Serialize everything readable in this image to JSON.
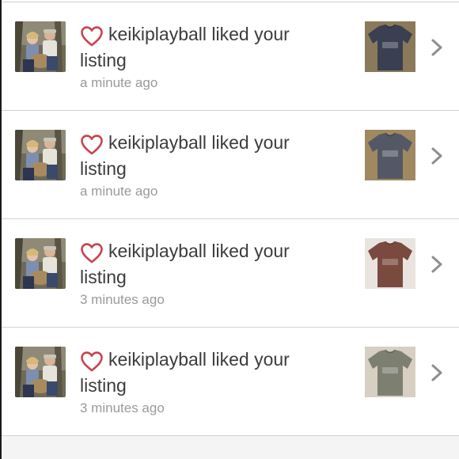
{
  "notifications": [
    {
      "username": "keikiplayball",
      "message": "keikiplayball liked your listing",
      "time": "a minute ago",
      "avatar_icon": "user-photo",
      "item_color": "#3a3f52",
      "item_bg": "#8a7a5a",
      "item_icon": "tshirt-thumbnail"
    },
    {
      "username": "keikiplayball",
      "message": "keikiplayball liked your listing",
      "time": "a minute ago",
      "avatar_icon": "user-photo",
      "item_color": "#545866",
      "item_bg": "#a08860",
      "item_icon": "tshirt-thumbnail"
    },
    {
      "username": "keikiplayball",
      "message": "keikiplayball liked your listing",
      "time": "3 minutes ago",
      "avatar_icon": "user-photo",
      "item_color": "#7a4a3e",
      "item_bg": "#e9e4df",
      "item_icon": "tshirt-thumbnail"
    },
    {
      "username": "keikiplayball",
      "message": "keikiplayball liked your listing",
      "time": "3 minutes ago",
      "avatar_icon": "user-photo",
      "item_color": "#7d8070",
      "item_bg": "#d7cfc2",
      "item_icon": "tshirt-thumbnail"
    }
  ],
  "colors": {
    "heart_outline": "#c9434e",
    "text": "#3c3c3c",
    "time": "#9a9a9a",
    "chevron": "#8e8e8e",
    "divider": "#d2d2d2"
  }
}
